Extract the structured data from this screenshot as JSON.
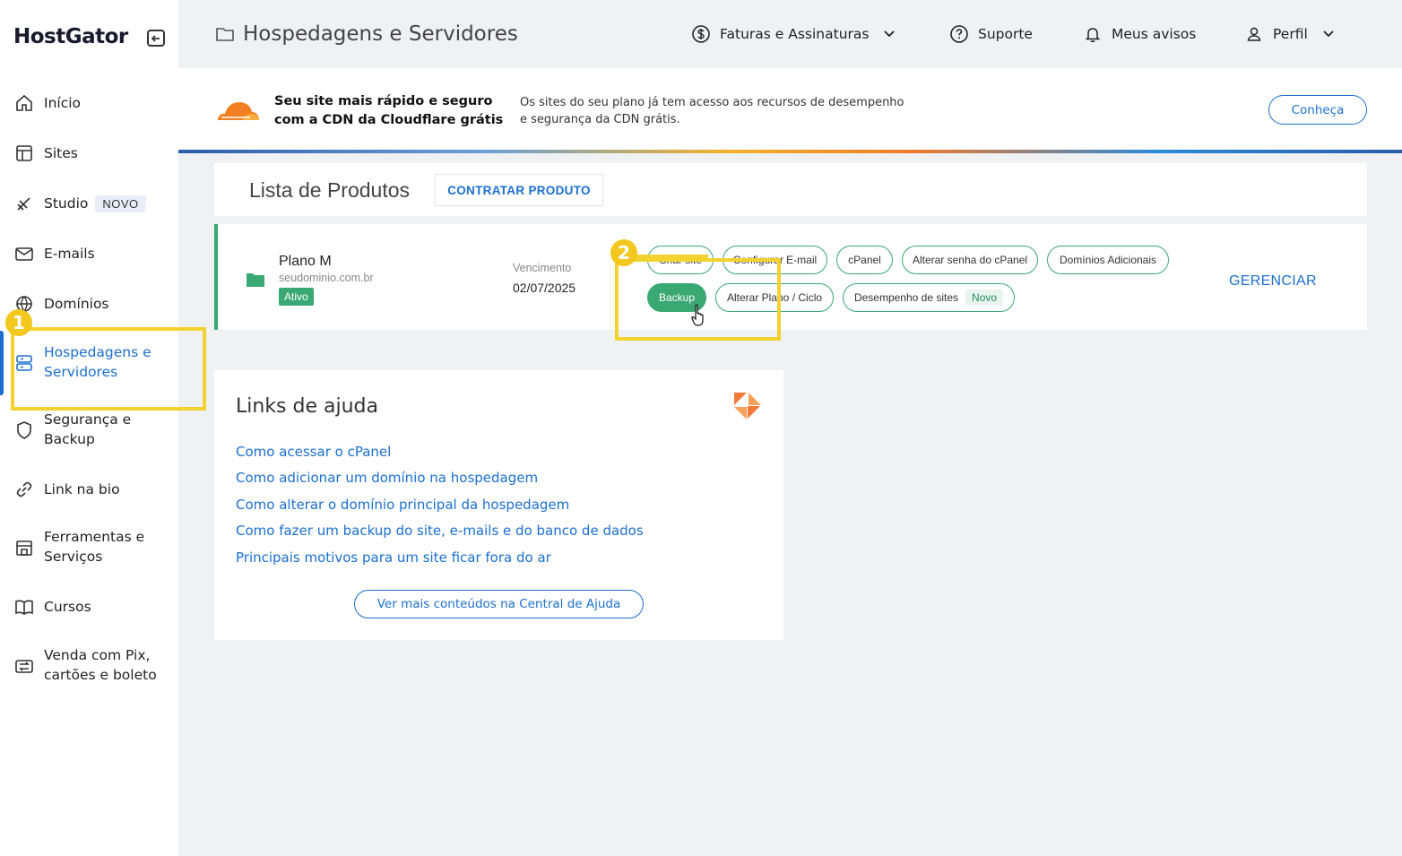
{
  "sidebar": {
    "logo": "HostGator",
    "items": [
      {
        "label": "Início",
        "icon": "home-icon"
      },
      {
        "label": "Sites",
        "icon": "layout-icon"
      },
      {
        "label": "Studio",
        "icon": "brush-icon",
        "badge": "NOVO"
      },
      {
        "label": "E-mails",
        "icon": "mail-icon"
      },
      {
        "label": "Domínios",
        "icon": "globe-icon"
      },
      {
        "label1": "Hospedagens e",
        "label2": "Servidores",
        "icon": "server-icon"
      },
      {
        "label1": "Segurança e",
        "label2": "Backup",
        "icon": "shield-icon"
      },
      {
        "label": "Link na bio",
        "icon": "link-icon"
      },
      {
        "label1": "Ferramentas e",
        "label2": "Serviços",
        "icon": "store-icon"
      },
      {
        "label": "Cursos",
        "icon": "book-icon"
      },
      {
        "label1": "Venda com Pix,",
        "label2": "cartões e boleto",
        "icon": "exchange-icon"
      }
    ]
  },
  "header": {
    "title": "Hospedagens e Servidores",
    "faturas": "Faturas e Assinaturas",
    "suporte": "Suporte",
    "avisos": "Meus avisos",
    "perfil": "Perfil"
  },
  "banner": {
    "strong1": "Seu site mais rápido e seguro",
    "strong2": "com a CDN da Cloudflare grátis",
    "text1": "Os sites do seu plano já tem acesso aos recursos de desempenho",
    "text2": "e segurança da CDN grátis.",
    "button": "Conheça"
  },
  "products": {
    "title": "Lista de Produtos",
    "contratar": "CONTRATAR PRODUTO",
    "plan": {
      "name": "Plano M",
      "domain": "seudominio.com.br",
      "status": "Ativo",
      "venc_label": "Vencimento",
      "venc_date": "02/07/2025"
    },
    "actions": {
      "criar_site": "Criar site",
      "configurar_email": "Configurar E-mail",
      "cpanel": "cPanel",
      "alterar_senha": "Alterar senha do cPanel",
      "dominios_adicionais": "Domínios Adicionais",
      "backup": "Backup",
      "alterar_plano": "Alterar Plano / Ciclo",
      "desempenho": "Desempenho de sites",
      "desempenho_badge": "Novo"
    },
    "gerenciar": "GERENCIAR"
  },
  "annotations": {
    "step1": "1",
    "step2": "2"
  },
  "help": {
    "title": "Links de ajuda",
    "links": [
      "Como acessar o cPanel",
      "Como adicionar um domínio na hospedagem",
      "Como alterar o domínio principal da hospedagem",
      "Como fazer um backup do site, e-mails e do banco de dados",
      "Principais motivos para um site ficar fora do ar"
    ],
    "more": "Ver mais conteúdos na Central de Ajuda"
  },
  "colors": {
    "accent": "#1b6fd1",
    "success": "#3aa873",
    "annotation": "#f2d22e"
  }
}
